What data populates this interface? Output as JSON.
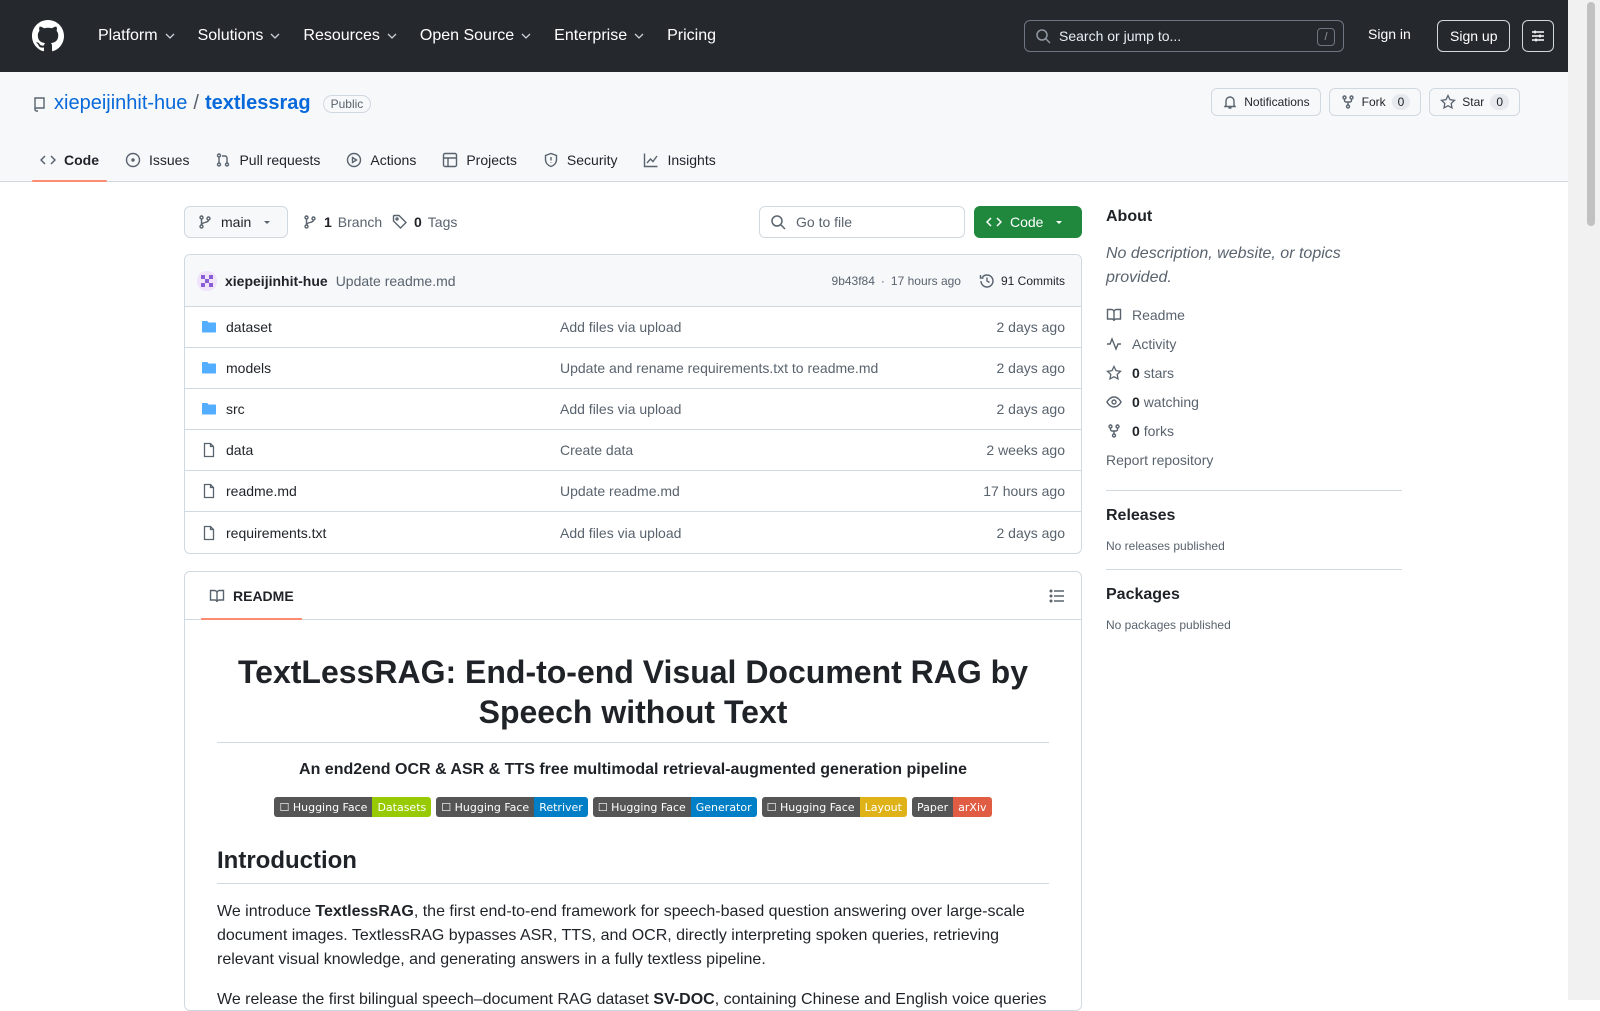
{
  "header": {
    "nav": [
      "Platform",
      "Solutions",
      "Resources",
      "Open Source",
      "Enterprise",
      "Pricing"
    ],
    "search_placeholder": "Search or jump to...",
    "search_key": "/",
    "signin": "Sign in",
    "signup": "Sign up"
  },
  "repo": {
    "owner": "xiepeijinhit-hue",
    "sep": "/",
    "name": "textlessrag",
    "visibility": "Public",
    "buttons": {
      "notifications": "Notifications",
      "fork": "Fork",
      "fork_count": "0",
      "star": "Star",
      "star_count": "0"
    },
    "tabs": [
      "Code",
      "Issues",
      "Pull requests",
      "Actions",
      "Projects",
      "Security",
      "Insights"
    ]
  },
  "toolbar": {
    "branch": "main",
    "branch_count": "1",
    "branch_label": "Branch",
    "tag_count": "0",
    "tag_label": "Tags",
    "goto": "Go to file",
    "code": "Code"
  },
  "commit": {
    "author": "xiepeijinhit-hue",
    "message": "Update readme.md",
    "hash": "9b43f84",
    "time": "17 hours ago",
    "dot": "·",
    "commits": "91 Commits"
  },
  "files": [
    {
      "type": "folder",
      "name": "dataset",
      "msg": "Add files via upload",
      "age": "2 days ago"
    },
    {
      "type": "folder",
      "name": "models",
      "msg": "Update and rename requirements.txt to readme.md",
      "age": "2 days ago"
    },
    {
      "type": "folder",
      "name": "src",
      "msg": "Add files via upload",
      "age": "2 days ago"
    },
    {
      "type": "file",
      "name": "data",
      "msg": "Create data",
      "age": "2 weeks ago"
    },
    {
      "type": "file",
      "name": "readme.md",
      "msg": "Update readme.md",
      "age": "17 hours ago"
    },
    {
      "type": "file",
      "name": "requirements.txt",
      "msg": "Add files via upload",
      "age": "2 days ago"
    }
  ],
  "readme": {
    "tab": "README",
    "title": "TextLessRAG: End-to-end Visual Document RAG by Speech without Text",
    "subtitle": "An end2end OCR & ASR & TTS free multimodal retrieval-augmented generation pipeline",
    "shields": [
      {
        "left": "☐ Hugging Face",
        "right": "Datasets",
        "color": "#97ca00"
      },
      {
        "left": "☐ Hugging Face",
        "right": "Retriver",
        "color": "#007ec6"
      },
      {
        "left": "☐ Hugging Face",
        "right": "Generator",
        "color": "#007ec6"
      },
      {
        "left": "☐ Hugging Face",
        "right": "Layout",
        "color": "#dfb317"
      },
      {
        "left": "Paper",
        "right": "arXiv",
        "color": "#e05d44"
      }
    ],
    "intro_heading": "Introduction",
    "intro_p1_a": "We introduce ",
    "intro_p1_b": "TextlessRAG",
    "intro_p1_c": ", the first end-to-end framework for speech-based question answering over large-scale document images. TextlessRAG bypasses ASR, TTS, and OCR, directly interpreting spoken queries, retrieving relevant visual knowledge, and generating answers in a fully textless pipeline.",
    "intro_p2_a": "We release the first bilingual speech–document RAG dataset ",
    "intro_p2_b": "SV-DOC",
    "intro_p2_c": ", containing Chinese and English voice queries"
  },
  "sidebar": {
    "about": "About",
    "desc": "No description, website, or topics provided.",
    "links": {
      "readme": "Readme",
      "activity": "Activity",
      "stars_n": "0",
      "stars": "stars",
      "watching_n": "0",
      "watching": "watching",
      "forks_n": "0",
      "forks": "forks",
      "report": "Report repository"
    },
    "releases": "Releases",
    "releases_none": "No releases published",
    "packages": "Packages",
    "packages_none": "No packages published"
  }
}
